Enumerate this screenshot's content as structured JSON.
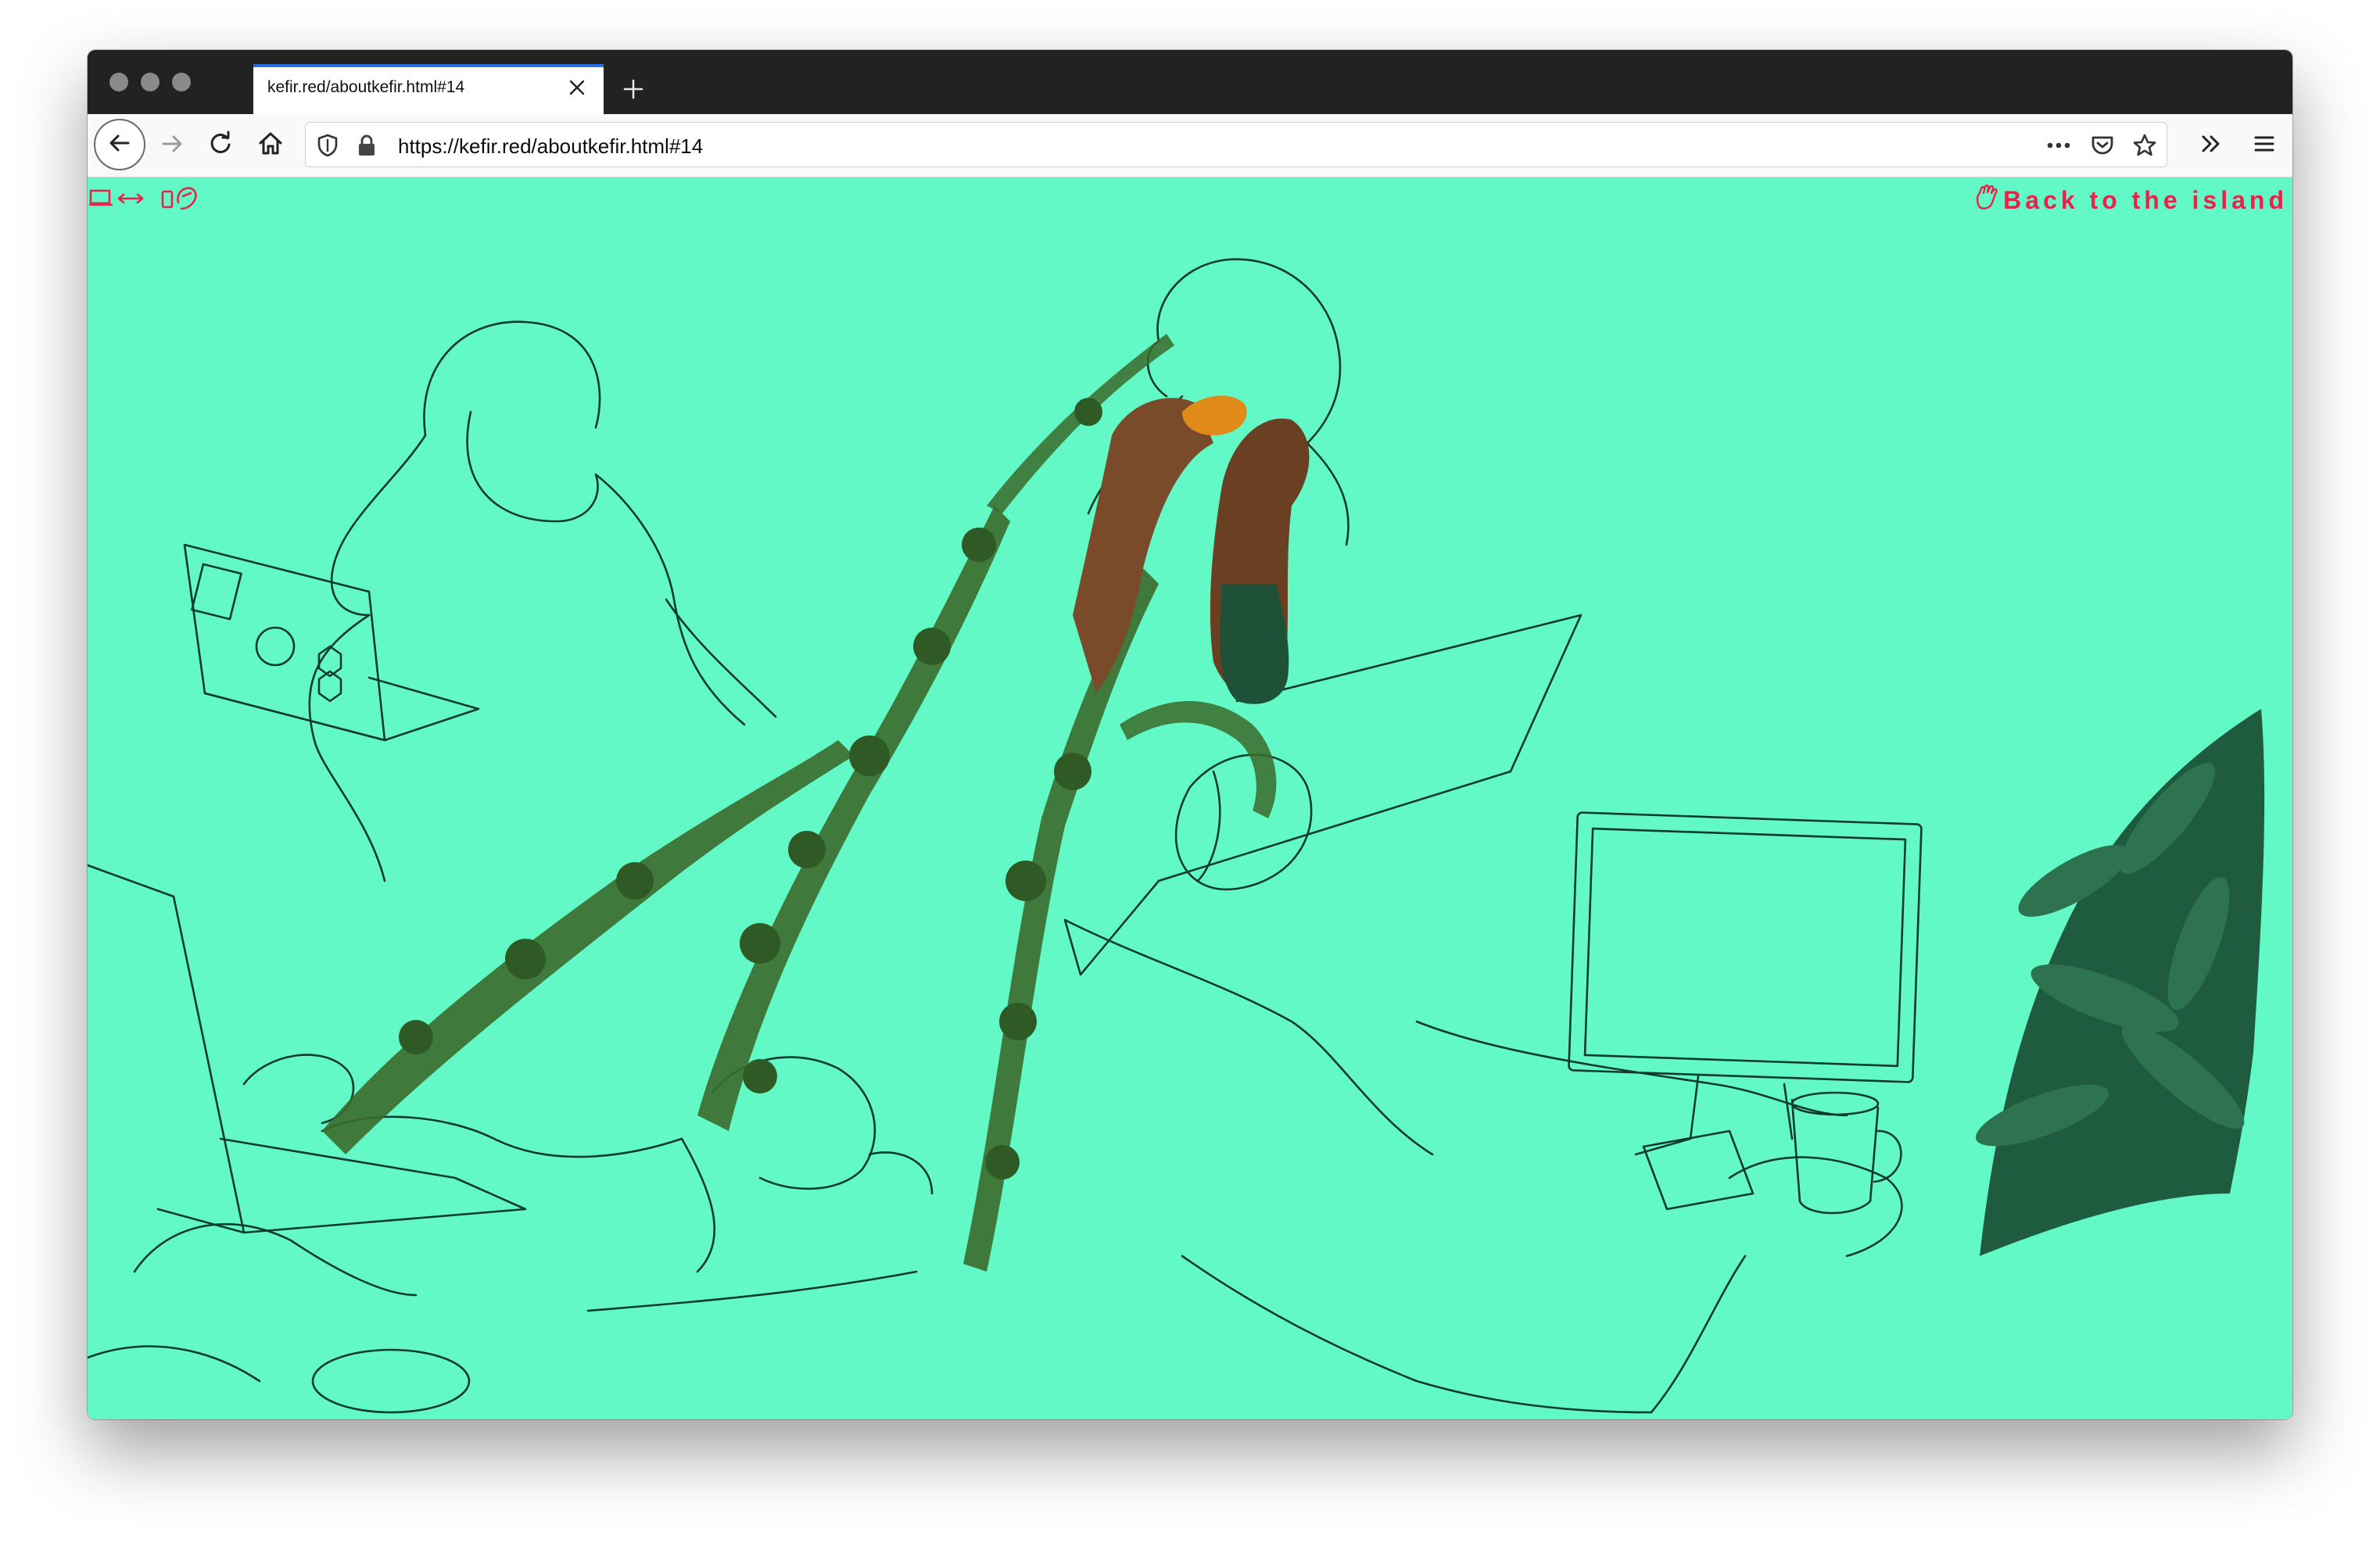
{
  "browser": {
    "tab_title": "kefir.red/aboutkefir.html#14",
    "url": "https://kefir.red/aboutkefir.html#14",
    "icons": [
      "back-arrow-icon",
      "forward-arrow-icon",
      "reload-icon",
      "home-icon",
      "shield-icon",
      "lock-icon",
      "more-icon",
      "pocket-icon",
      "star-icon",
      "overflow-icon",
      "menu-icon",
      "close-icon",
      "plus-icon"
    ]
  },
  "page": {
    "back_link_label": "Back to the island",
    "icons": [
      "laptop-resize-icon",
      "phone-touch-icon",
      "hand-icon"
    ],
    "colors": {
      "background": "#62f9c6",
      "line_art": "#0e3b2e",
      "accent": "#e8224b"
    }
  }
}
